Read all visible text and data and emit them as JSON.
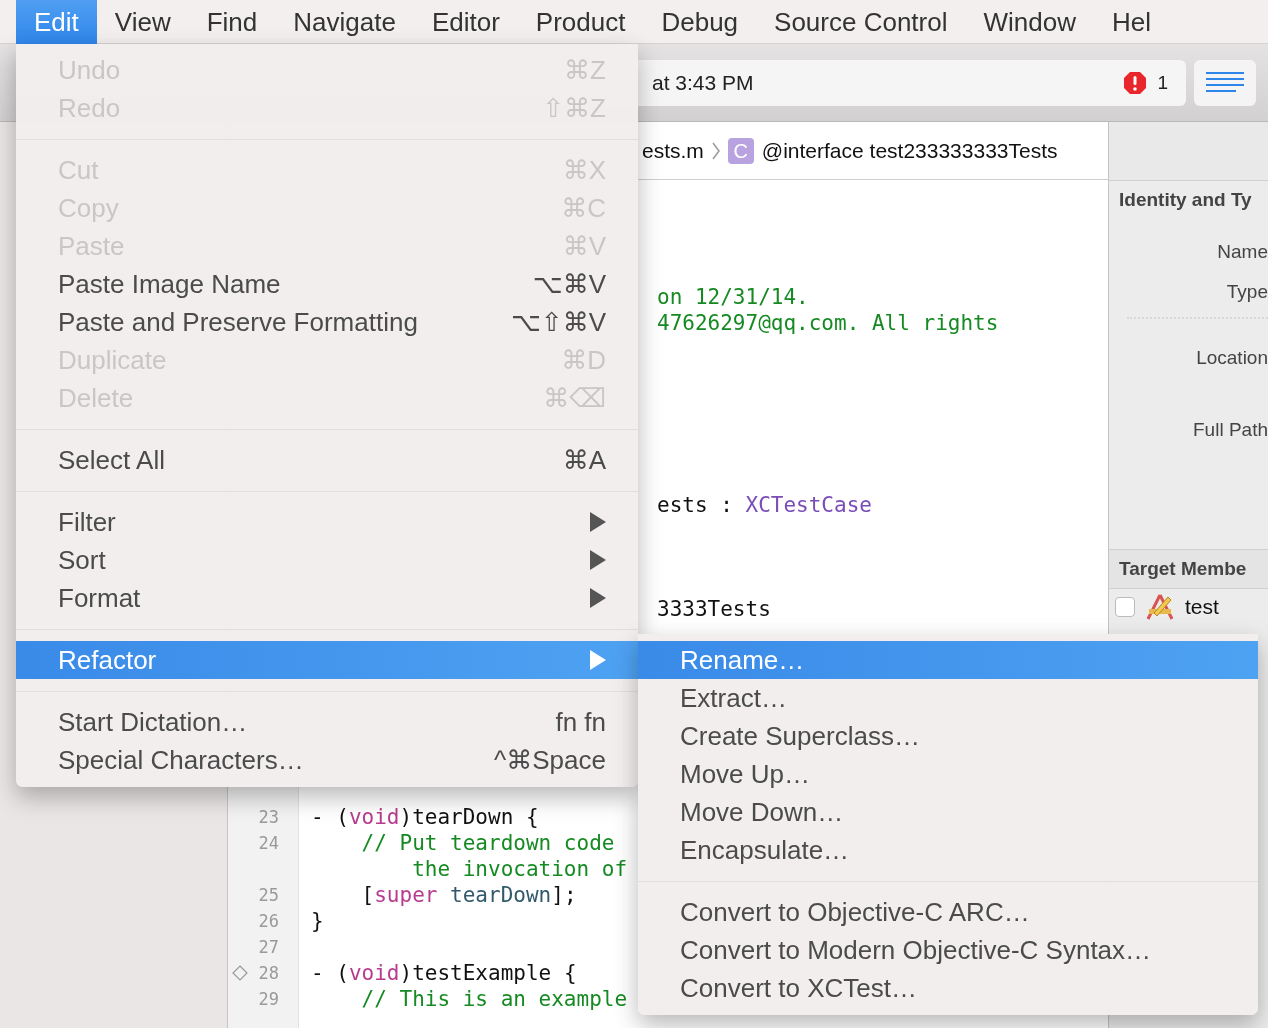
{
  "menubar": {
    "items": [
      {
        "label": "Edit",
        "selected": true
      },
      {
        "label": "View",
        "selected": false
      },
      {
        "label": "Find",
        "selected": false
      },
      {
        "label": "Navigate",
        "selected": false
      },
      {
        "label": "Editor",
        "selected": false
      },
      {
        "label": "Product",
        "selected": false
      },
      {
        "label": "Debug",
        "selected": false
      },
      {
        "label": "Source Control",
        "selected": false
      },
      {
        "label": "Window",
        "selected": false
      },
      {
        "label": "Hel",
        "selected": false
      }
    ]
  },
  "toolbar": {
    "activity": "at 3:43 PM",
    "error_count": "1",
    "navigator_button": {
      "selected": true
    }
  },
  "editor": {
    "breadcrumb": [
      {
        "text": "ests.m"
      },
      {
        "icon_letter": "C",
        "text": "@interface test233333333Tests"
      }
    ],
    "upper_lines": [
      {
        "segments": [
          {
            "text": "on 12/31/14.",
            "kind": "comment"
          }
        ]
      },
      {
        "segments": [
          {
            "text": "47626297@qq.com. All rights",
            "kind": "comment"
          }
        ]
      },
      {
        "segments": [
          {
            "text": "ests",
            "kind": "plain"
          },
          {
            "text": " : ",
            "kind": "plain"
          },
          {
            "text": "XCTestCase",
            "kind": "class"
          }
        ]
      },
      {
        "segments": [
          {
            "text": "3333Tests",
            "kind": "plain"
          }
        ]
      }
    ],
    "lines": [
      {
        "number": "23",
        "test_diamond": false,
        "segments": [
          {
            "text": "- (",
            "kind": "plain"
          },
          {
            "text": "void",
            "kind": "keyword"
          },
          {
            "text": ")tearDown {",
            "kind": "plain"
          }
        ]
      },
      {
        "number": "24",
        "test_diamond": false,
        "segments": [
          {
            "text": "    // Put teardown code",
            "kind": "comment"
          }
        ]
      },
      {
        "test_diamond": false,
        "segments": [
          {
            "text": "        the invocation of",
            "kind": "comment"
          }
        ]
      },
      {
        "number": "25",
        "test_diamond": false,
        "segments": [
          {
            "text": "    [",
            "kind": "plain"
          },
          {
            "text": "super",
            "kind": "keyword"
          },
          {
            "text": " tearDown",
            "kind": "method"
          },
          {
            "text": "];",
            "kind": "plain"
          }
        ]
      },
      {
        "number": "26",
        "test_diamond": false,
        "segments": [
          {
            "text": "}",
            "kind": "plain"
          }
        ]
      },
      {
        "number": "27",
        "test_diamond": false
      },
      {
        "number": "28",
        "test_diamond": true,
        "segments": [
          {
            "text": "- (",
            "kind": "plain"
          },
          {
            "text": "void",
            "kind": "keyword"
          },
          {
            "text": ")testExample {",
            "kind": "plain"
          }
        ]
      },
      {
        "number": "29",
        "test_diamond": false,
        "segments": [
          {
            "text": "    // This is an example",
            "kind": "comment"
          }
        ]
      }
    ]
  },
  "inspector": {
    "identity": {
      "title": "Identity and Ty",
      "fields": [
        "Name",
        "Type",
        "Location",
        "Full Path"
      ]
    },
    "membership": {
      "title": "Target Membe",
      "targets": [
        {
          "name": "test",
          "checked": false
        }
      ]
    }
  },
  "edit_menu": {
    "groups": [
      [
        {
          "label": "Undo",
          "shortcut": "⌘Z",
          "disabled": true,
          "submenu": false,
          "selected": false
        },
        {
          "label": "Redo",
          "shortcut": "⇧⌘Z",
          "disabled": true,
          "submenu": false,
          "selected": false
        }
      ],
      [
        {
          "label": "Cut",
          "shortcut": "⌘X",
          "disabled": true,
          "submenu": false,
          "selected": false
        },
        {
          "label": "Copy",
          "shortcut": "⌘C",
          "disabled": true,
          "submenu": false,
          "selected": false
        },
        {
          "label": "Paste",
          "shortcut": "⌘V",
          "disabled": true,
          "submenu": false,
          "selected": false
        },
        {
          "label": "Paste Image Name",
          "shortcut": "⌥⌘V",
          "disabled": false,
          "submenu": false,
          "selected": false
        },
        {
          "label": "Paste and Preserve Formatting",
          "shortcut": "⌥⇧⌘V",
          "disabled": false,
          "submenu": false,
          "selected": false
        },
        {
          "label": "Duplicate",
          "shortcut": "⌘D",
          "disabled": true,
          "submenu": false,
          "selected": false
        },
        {
          "label": "Delete",
          "shortcut": "⌘⌫",
          "disabled": true,
          "submenu": false,
          "selected": false
        }
      ],
      [
        {
          "label": "Select All",
          "shortcut": "⌘A",
          "disabled": false,
          "submenu": false,
          "selected": false
        }
      ],
      [
        {
          "label": "Filter",
          "disabled": false,
          "submenu": true,
          "selected": false
        },
        {
          "label": "Sort",
          "disabled": false,
          "submenu": true,
          "selected": false
        },
        {
          "label": "Format",
          "disabled": false,
          "submenu": true,
          "selected": false
        }
      ],
      [
        {
          "label": "Refactor",
          "disabled": false,
          "submenu": true,
          "selected": true
        }
      ],
      [
        {
          "label": "Start Dictation…",
          "shortcut": "fn fn",
          "disabled": false,
          "submenu": false,
          "selected": false
        },
        {
          "label": "Special Characters…",
          "shortcut": "^⌘Space",
          "disabled": false,
          "submenu": false,
          "selected": false
        }
      ]
    ]
  },
  "refactor_submenu": {
    "groups": [
      [
        {
          "label": "Rename…",
          "disabled": false,
          "submenu": false,
          "selected": true
        },
        {
          "label": "Extract…",
          "disabled": false,
          "submenu": false,
          "selected": false
        },
        {
          "label": "Create Superclass…",
          "disabled": false,
          "submenu": false,
          "selected": false
        },
        {
          "label": "Move Up…",
          "disabled": false,
          "submenu": false,
          "selected": false
        },
        {
          "label": "Move Down…",
          "disabled": false,
          "submenu": false,
          "selected": false
        },
        {
          "label": "Encapsulate…",
          "disabled": false,
          "submenu": false,
          "selected": false
        }
      ],
      [
        {
          "label": "Convert to Objective-C ARC…",
          "disabled": false,
          "submenu": false,
          "selected": false
        },
        {
          "label": "Convert to Modern Objective-C Syntax…",
          "disabled": false,
          "submenu": false,
          "selected": false
        },
        {
          "label": "Convert to XCTest…",
          "disabled": false,
          "submenu": false,
          "selected": false
        }
      ]
    ]
  }
}
